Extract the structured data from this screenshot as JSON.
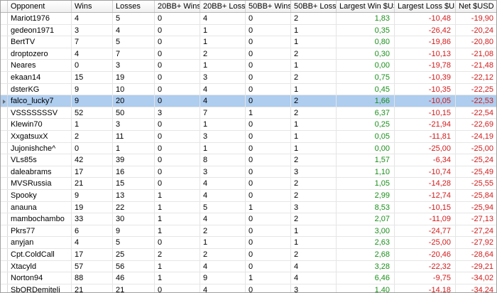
{
  "columns": [
    "Opponent",
    "Wins",
    "Losses",
    "20BB+ Wins",
    "20BB+ Losses",
    "50BB+ Wins",
    "50BB+ Losses",
    "Largest Win $USD",
    "Largest Loss $USD",
    "Net $USD"
  ],
  "selected_index": 7,
  "colors": {
    "positive": "#1a8f1a",
    "negative": "#d21a1a",
    "selected_row": "#aecdef"
  },
  "rows": [
    [
      "Mariot1976",
      "4",
      "5",
      "0",
      "4",
      "0",
      "2",
      "1,83",
      "-10,48",
      "-19,90"
    ],
    [
      "gedeon1971",
      "3",
      "4",
      "0",
      "1",
      "0",
      "1",
      "0,35",
      "-26,42",
      "-20,24"
    ],
    [
      "BertTV",
      "7",
      "5",
      "0",
      "1",
      "0",
      "1",
      "0,80",
      "-19,86",
      "-20,80"
    ],
    [
      "droptozero",
      "4",
      "7",
      "0",
      "2",
      "0",
      "2",
      "0,30",
      "-10,13",
      "-21,08"
    ],
    [
      "Neares",
      "0",
      "3",
      "0",
      "1",
      "0",
      "1",
      "0,00",
      "-19,78",
      "-21,48"
    ],
    [
      "ekaan14",
      "15",
      "19",
      "0",
      "3",
      "0",
      "2",
      "0,75",
      "-10,39",
      "-22,12"
    ],
    [
      "dsterKG",
      "9",
      "10",
      "0",
      "4",
      "0",
      "1",
      "0,45",
      "-10,35",
      "-22,25"
    ],
    [
      "falco_lucky7",
      "9",
      "20",
      "0",
      "4",
      "0",
      "2",
      "1,66",
      "-10,05",
      "-22,53"
    ],
    [
      "VSSSSSSSV",
      "52",
      "50",
      "3",
      "7",
      "1",
      "2",
      "6,37",
      "-10,15",
      "-22,54"
    ],
    [
      "Klewin70",
      "1",
      "3",
      "0",
      "1",
      "0",
      "1",
      "0,25",
      "-21,94",
      "-22,69"
    ],
    [
      "XxgatsuxX",
      "2",
      "11",
      "0",
      "3",
      "0",
      "1",
      "0,05",
      "-11,81",
      "-24,19"
    ],
    [
      "Jujonishche^",
      "0",
      "1",
      "0",
      "1",
      "0",
      "1",
      "0,00",
      "-25,00",
      "-25,00"
    ],
    [
      "VLs85s",
      "42",
      "39",
      "0",
      "8",
      "0",
      "2",
      "1,57",
      "-6,34",
      "-25,24"
    ],
    [
      "daleabrams",
      "17",
      "16",
      "0",
      "3",
      "0",
      "3",
      "1,10",
      "-10,74",
      "-25,49"
    ],
    [
      "MVSRussia",
      "21",
      "15",
      "0",
      "4",
      "0",
      "2",
      "1,05",
      "-14,28",
      "-25,55"
    ],
    [
      "Spooky",
      "9",
      "13",
      "1",
      "4",
      "0",
      "2",
      "2,99",
      "-12,74",
      "-25,84"
    ],
    [
      "anauna",
      "19",
      "22",
      "1",
      "5",
      "1",
      "3",
      "8,53",
      "-10,15",
      "-25,94"
    ],
    [
      "mambochambo",
      "33",
      "30",
      "1",
      "4",
      "0",
      "2",
      "2,07",
      "-11,09",
      "-27,13"
    ],
    [
      "Pkrs77",
      "6",
      "9",
      "1",
      "2",
      "0",
      "1",
      "3,00",
      "-24,77",
      "-27,24"
    ],
    [
      "anyjan",
      "4",
      "5",
      "0",
      "1",
      "0",
      "1",
      "2,63",
      "-25,00",
      "-27,92"
    ],
    [
      "Cpt.ColdCall",
      "17",
      "25",
      "2",
      "2",
      "0",
      "2",
      "2,68",
      "-20,46",
      "-28,64"
    ],
    [
      "Xtacyld",
      "57",
      "56",
      "1",
      "4",
      "0",
      "4",
      "3,28",
      "-22,32",
      "-29,21"
    ],
    [
      "Norton94",
      "88",
      "46",
      "1",
      "9",
      "1",
      "4",
      "6,46",
      "-9,75",
      "-34,02"
    ],
    [
      "SbORDemiteli",
      "21",
      "21",
      "0",
      "4",
      "0",
      "3",
      "1,40",
      "-14,18",
      "-34,24"
    ]
  ]
}
